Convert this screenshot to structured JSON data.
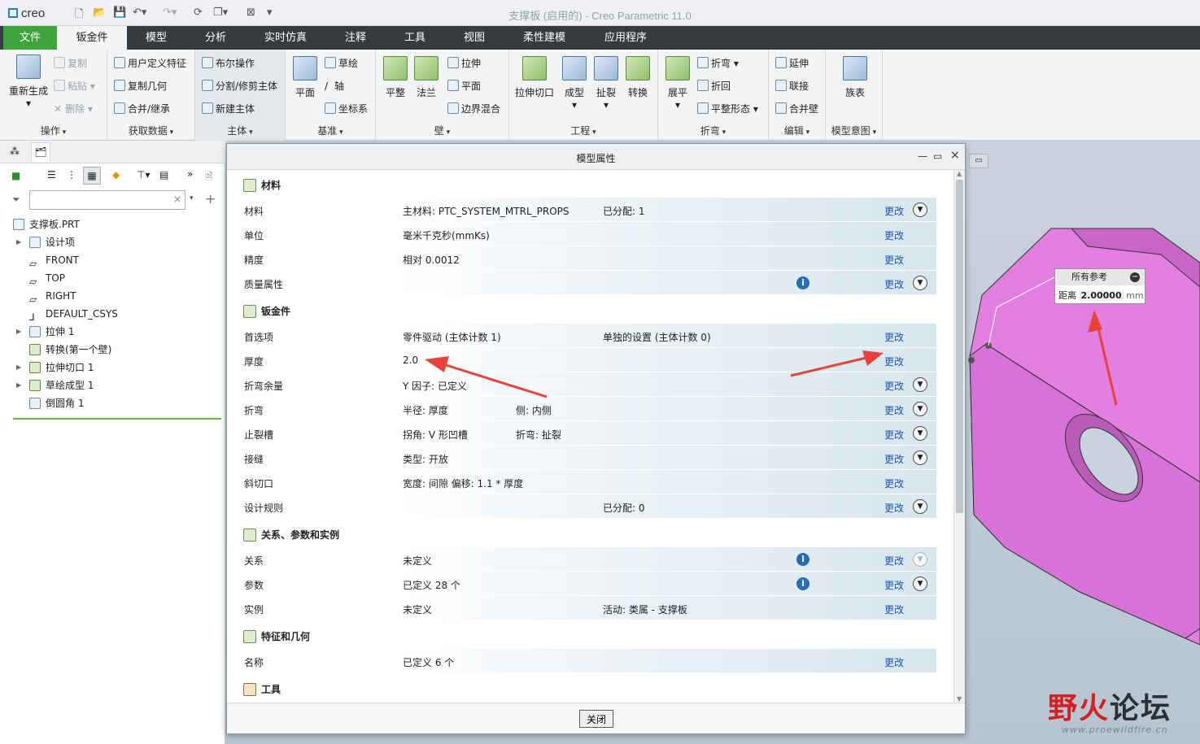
{
  "app": {
    "logo": "creo",
    "title": "支撑板 (启用的) - Creo Parametric 11.0"
  },
  "menu": {
    "tabs": [
      "文件",
      "钣金件",
      "模型",
      "分析",
      "实时仿真",
      "注释",
      "工具",
      "视图",
      "柔性建模",
      "应用程序"
    ]
  },
  "ribbon": {
    "groups": {
      "ops": "操作",
      "getdata": "获取数据",
      "body": "主体",
      "datum": "基准",
      "wall": "壁",
      "eng": "工程",
      "bend": "折弯",
      "edit": "编辑",
      "intent": "模型意图"
    },
    "items": {
      "regen": "重新生成",
      "copy": "复制",
      "paste": "粘贴",
      "delete": "删除",
      "udf": "用户定义特征",
      "copygeom": "复制几何",
      "merge": "合并/继承",
      "boolean": "布尔操作",
      "split": "分割/修剪主体",
      "newbody": "新建主体",
      "sketch": "草绘",
      "plane": "平面",
      "axis": "轴",
      "csys": "坐标系",
      "flat": "平整",
      "flange": "法兰",
      "extrude": "拉伸",
      "planar": "平面",
      "blend": "边界混合",
      "extcut": "拉伸切口",
      "form": "成型",
      "rip": "扯裂",
      "convert": "转换",
      "unbend": "展平",
      "bendtool": "折弯",
      "bendback": "折回",
      "flatform": "平整形态",
      "extend": "延伸",
      "join": "联接",
      "mergewall": "合并壁",
      "familytable": "族表"
    }
  },
  "tree": {
    "root": "支撑板.PRT",
    "nodes": [
      "设计项",
      "FRONT",
      "TOP",
      "RIGHT",
      "DEFAULT_CSYS",
      "拉伸 1",
      "转换(第一个壁)",
      "拉伸切口 1",
      "草绘成型 1",
      "倒圆角 1"
    ]
  },
  "dialog": {
    "title": "模型属性",
    "change": "更改",
    "close": "关闭",
    "sections": {
      "material": "材料",
      "sheetmetal": "钣金件",
      "relations": "关系、参数和实例",
      "features": "特征和几何",
      "tools": "工具"
    },
    "material_rows": [
      {
        "label": "材料",
        "v1": "主材料: PTC_SYSTEM_MTRL_PROPS",
        "v2": "已分配: 1"
      },
      {
        "label": "单位",
        "v1": "毫米千克秒(mmKs)",
        "v2": ""
      },
      {
        "label": "精度",
        "v1": "相对 0.0012",
        "v2": ""
      },
      {
        "label": "质量属性",
        "v1": "",
        "v2": ""
      }
    ],
    "sm_rows": [
      {
        "label": "首选项",
        "v1": "零件驱动 (主体计数 1)",
        "v2": "单独的设置 (主体计数 0)"
      },
      {
        "label": "厚度",
        "v1": "2.0",
        "v2": ""
      },
      {
        "label": "折弯余量",
        "v1": "Y 因子: 已定义",
        "v2": ""
      },
      {
        "label": "折弯",
        "v1": "半径: 厚度",
        "v3": "侧: 内侧"
      },
      {
        "label": "止裂槽",
        "v1": "拐角: V 形凹槽",
        "v3": "折弯: 扯裂"
      },
      {
        "label": "接缝",
        "v1": "类型: 开放",
        "v2": ""
      },
      {
        "label": "斜切口",
        "v1": "宽度: 间隙 偏移: 1.1 * 厚度",
        "v2": ""
      },
      {
        "label": "设计规则",
        "v1": "",
        "v2": "已分配: 0"
      }
    ],
    "rel_rows": [
      {
        "label": "关系",
        "v1": "未定义",
        "v2": ""
      },
      {
        "label": "参数",
        "v1": "已定义 28 个",
        "v2": ""
      },
      {
        "label": "实例",
        "v1": "未定义",
        "v2": "活动: 类属 - 支撑板"
      }
    ],
    "feat_rows": [
      {
        "label": "名称",
        "v1": "已定义 6 个",
        "v2": ""
      }
    ]
  },
  "callout": {
    "title": "所有参考",
    "label": "距离",
    "value": "2.00000",
    "unit": "mm"
  },
  "watermark": {
    "brand_red": "野火",
    "brand_dark": "论坛",
    "url": "www.proewildfire.cn"
  },
  "colors": {
    "file_tab": "#3ea33a",
    "menubar": "#363b3f",
    "part": "#e27fe0",
    "link": "#1c55b8",
    "arrow": "#e8423a"
  }
}
